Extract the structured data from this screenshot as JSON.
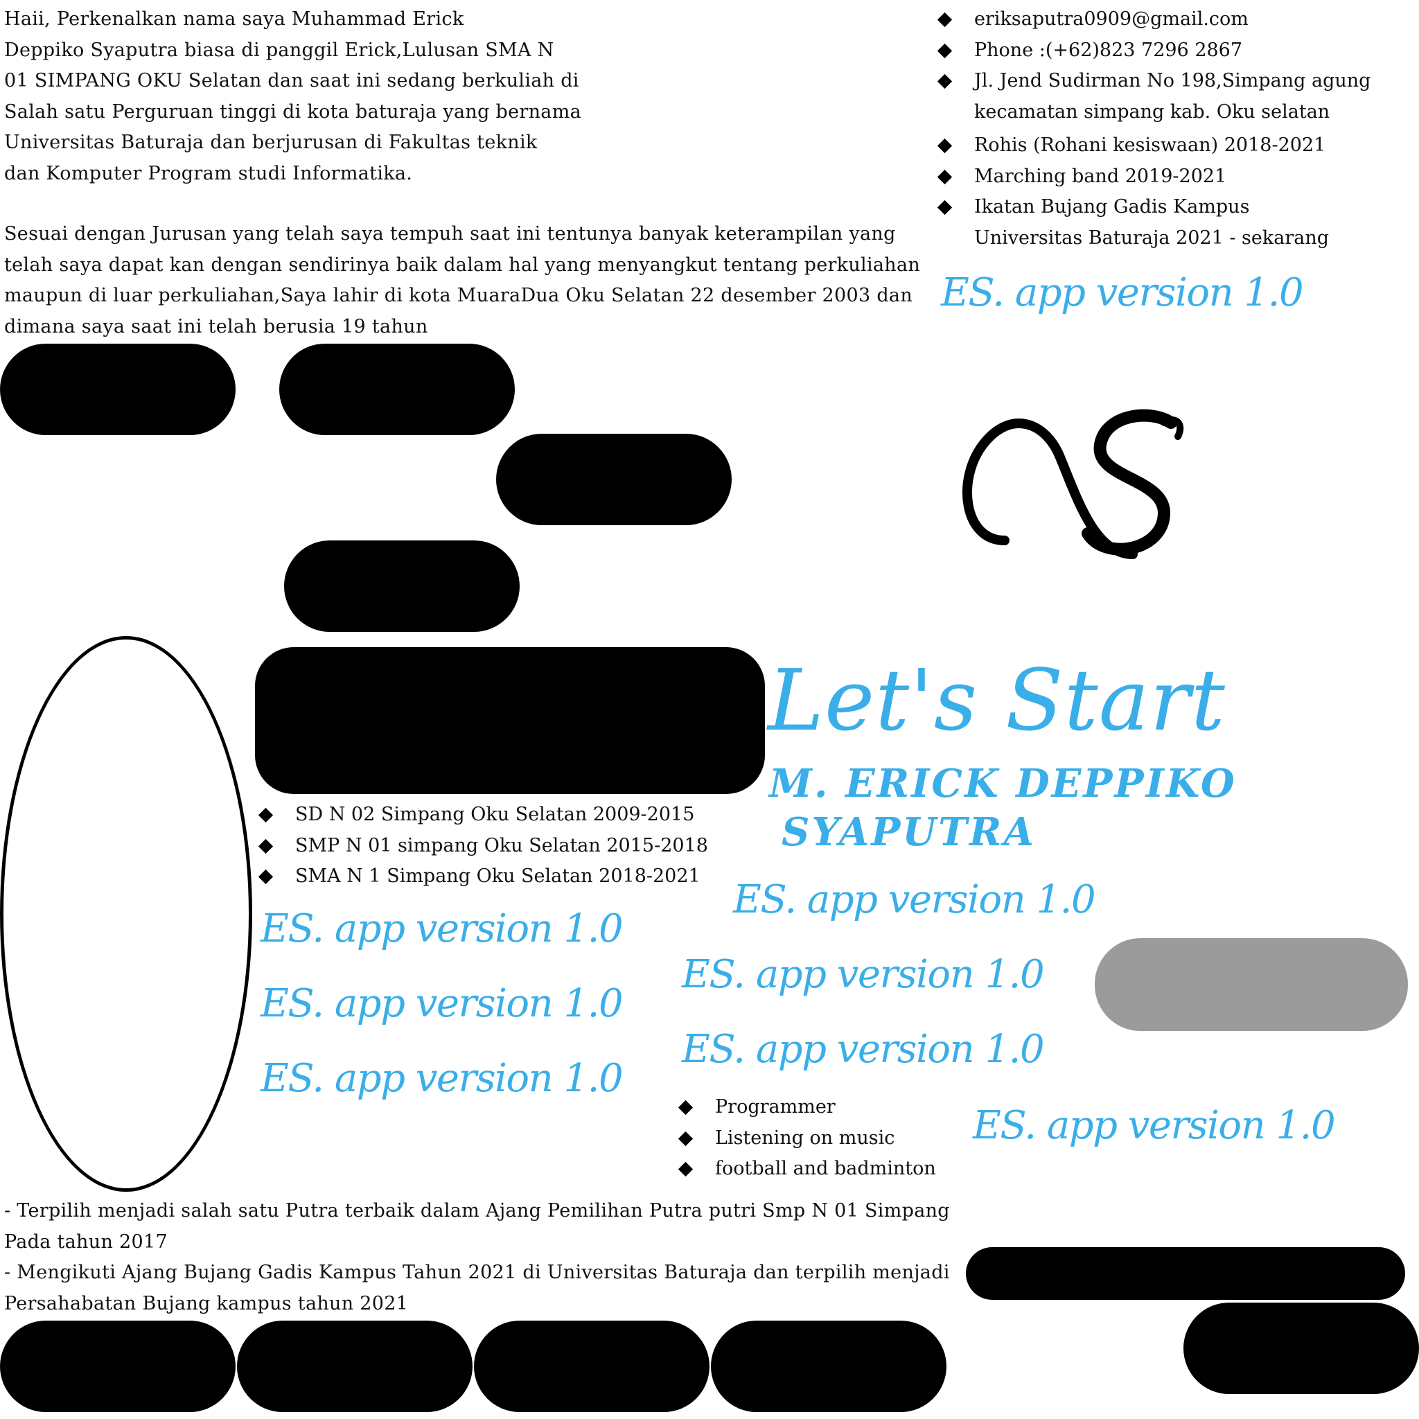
{
  "intro": {
    "paragraph1": "Haii, Perkenalkan nama saya Muhammad Erick\nDeppiko Syaputra biasa di panggil Erick,Lulusan SMA N\n01 SIMPANG OKU Selatan dan saat ini sedang berkuliah di\nSalah satu Perguruan tinggi di kota baturaja yang bernama\nUniversitas Baturaja dan berjurusan di Fakultas teknik\ndan Komputer Program studi Informatika.",
    "paragraph2": "Sesuai dengan Jurusan yang telah saya tempuh saat ini tentunya banyak keterampilan yang\ntelah saya dapat kan dengan sendirinya baik dalam hal yang menyangkut tentang perkuliahan\nmaupun di luar perkuliahan,Saya lahir di kota MuaraDua Oku Selatan 22 desember 2003 dan\ndimana saya saat ini telah berusia 19 tahun"
  },
  "contact": [
    "eriksaputra0909@gmail.com",
    "Phone :(+62)823 7296 2867",
    "Jl. Jend Sudirman No 198,Simpang agung\nkecamatan simpang kab. Oku selatan"
  ],
  "organizations": [
    "Rohis (Rohani kesiswaan) 2018-2021",
    "Marching band 2019-2021",
    "Ikatan Bujang Gadis Kampus\nUniversitas Baturaja 2021 - sekarang"
  ],
  "education": [
    "SD N 02 Simpang Oku Selatan 2009-2015",
    "SMP N 01 simpang Oku Selatan 2015-2018",
    "SMA N 1 Simpang Oku Selatan 2018-2021"
  ],
  "hobbies": [
    "Programmer",
    "Listening on music",
    "football and badminton"
  ],
  "achievements": "- Terpilih menjadi salah satu Putra terbaik dalam Ajang Pemilihan Putra putri Smp N 01 Simpang\nPada tahun 2017\n- Mengikuti Ajang Bujang Gadis Kampus Tahun 2021 di Universitas Baturaja dan terpilih menjadi\nPersahabatan Bujang kampus tahun 2021",
  "brand": {
    "watermark": "ES. app version 1.0",
    "monogram": "S",
    "accent_color": "#3aaee8"
  },
  "hero": {
    "title": "Let's Start",
    "name_line1": "M. ERICK DEPPIKO",
    "name_line2": "SYAPUTRA"
  },
  "redactions": {
    "fill": "#000000",
    "gray_fill": "#9b9b9b"
  }
}
